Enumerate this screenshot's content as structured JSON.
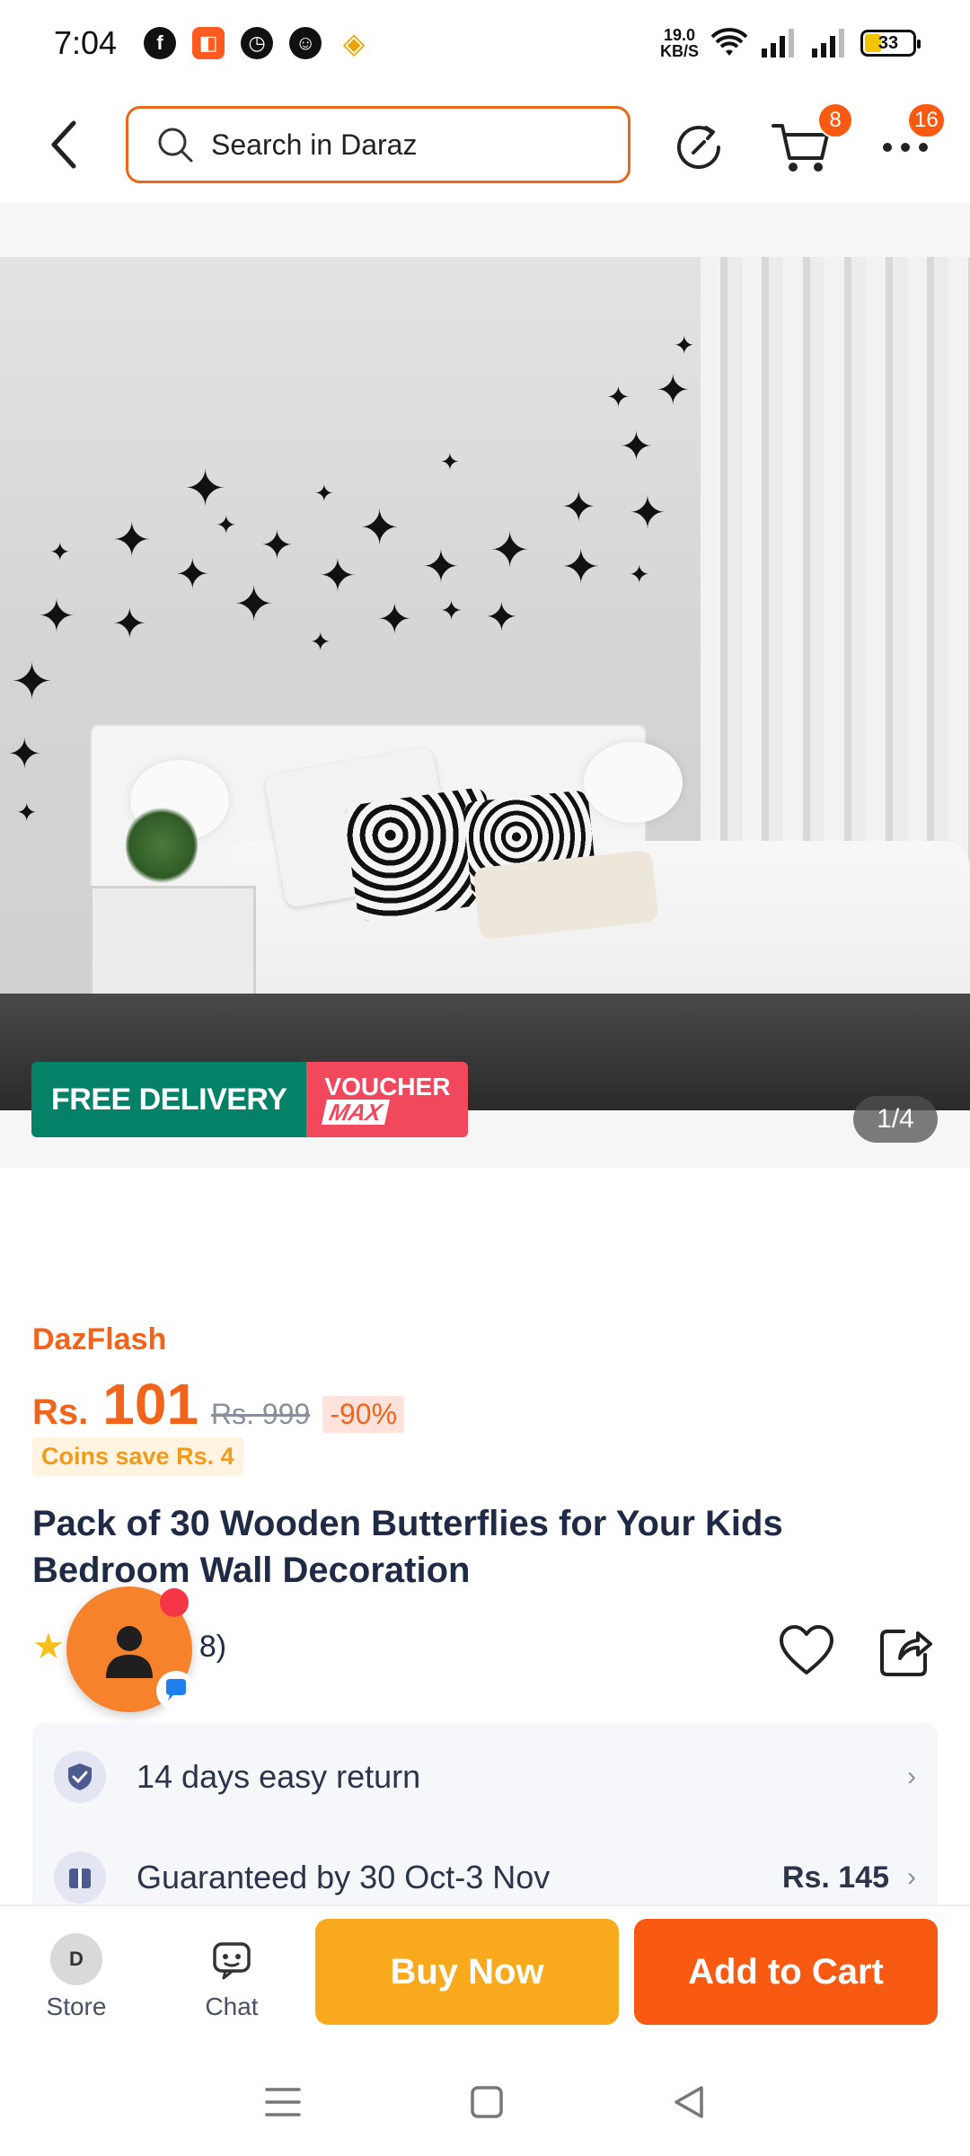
{
  "status_bar": {
    "time": "7:04",
    "net_speed_value": "19.0",
    "net_speed_unit": "KB/S",
    "battery_level": "33",
    "icons": [
      "facebook-icon",
      "app-icon",
      "timer-icon",
      "bot-icon",
      "binance-icon",
      "wifi-icon",
      "signal-icon",
      "signal-icon"
    ]
  },
  "header": {
    "search_placeholder": "Search in Daraz",
    "cart_badge": "8",
    "more_badge": "16"
  },
  "gallery": {
    "promo_free": "FREE DELIVERY",
    "promo_voucher": "VOUCHER",
    "promo_max": "MAX",
    "page_indicator": "1/4"
  },
  "product": {
    "flash_label": "DazFlash",
    "currency": "Rs.",
    "price": "101",
    "old_price": "Rs. 999",
    "discount": "-90%",
    "coins": "Coins save Rs. 4",
    "title": "Pack of 30 Wooden Butterflies for Your Kids Bedroom Wall Decoration",
    "rating_count": "8)"
  },
  "services": {
    "return_text": "14 days easy return",
    "delivery_text": "Guaranteed by 30 Oct-3 Nov",
    "delivery_price": "Rs. 145"
  },
  "bottom_bar": {
    "store_label": "Store",
    "store_logo": "D",
    "chat_label": "Chat",
    "buy_now": "Buy Now",
    "add_to_cart": "Add to Cart"
  },
  "colors": {
    "accent_orange": "#f85a12",
    "buy_now_yellow": "#f9a91c",
    "free_delivery_green": "#058167",
    "voucher_pink": "#f2485e"
  }
}
